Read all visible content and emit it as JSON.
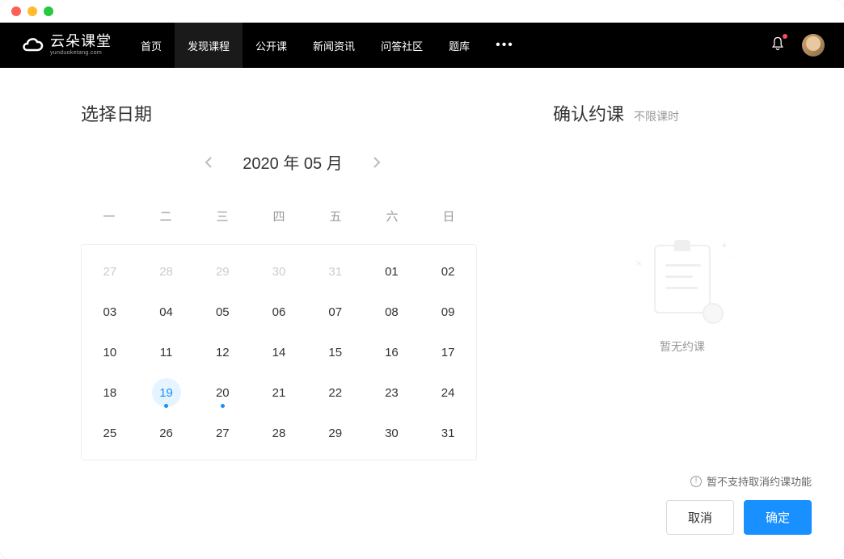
{
  "logo": {
    "main": "云朵课堂",
    "sub": "yunduoketang.com"
  },
  "nav": {
    "items": [
      {
        "label": "首页",
        "active": false
      },
      {
        "label": "发现课程",
        "active": true
      },
      {
        "label": "公开课",
        "active": false
      },
      {
        "label": "新闻资讯",
        "active": false
      },
      {
        "label": "问答社区",
        "active": false
      },
      {
        "label": "题库",
        "active": false
      }
    ]
  },
  "calendar": {
    "title": "选择日期",
    "month_label": "2020 年 05 月",
    "weekdays": [
      "一",
      "二",
      "三",
      "四",
      "五",
      "六",
      "日"
    ],
    "days": [
      {
        "num": "27",
        "other": true
      },
      {
        "num": "28",
        "other": true
      },
      {
        "num": "29",
        "other": true
      },
      {
        "num": "30",
        "other": true
      },
      {
        "num": "31",
        "other": true
      },
      {
        "num": "01"
      },
      {
        "num": "02"
      },
      {
        "num": "03"
      },
      {
        "num": "04"
      },
      {
        "num": "05"
      },
      {
        "num": "06"
      },
      {
        "num": "07"
      },
      {
        "num": "08"
      },
      {
        "num": "09"
      },
      {
        "num": "10"
      },
      {
        "num": "11"
      },
      {
        "num": "12"
      },
      {
        "num": "14"
      },
      {
        "num": "15"
      },
      {
        "num": "16"
      },
      {
        "num": "17"
      },
      {
        "num": "18"
      },
      {
        "num": "19",
        "selected": true,
        "dot": true
      },
      {
        "num": "20",
        "dot": true
      },
      {
        "num": "21"
      },
      {
        "num": "22"
      },
      {
        "num": "23"
      },
      {
        "num": "24"
      },
      {
        "num": "25"
      },
      {
        "num": "26"
      },
      {
        "num": "27"
      },
      {
        "num": "28"
      },
      {
        "num": "29"
      },
      {
        "num": "30"
      },
      {
        "num": "31"
      }
    ]
  },
  "confirm": {
    "title": "确认约课",
    "subtitle": "不限课时",
    "empty_text": "暂无约课",
    "warning": "暂不支持取消约课功能",
    "cancel": "取消",
    "ok": "确定"
  }
}
